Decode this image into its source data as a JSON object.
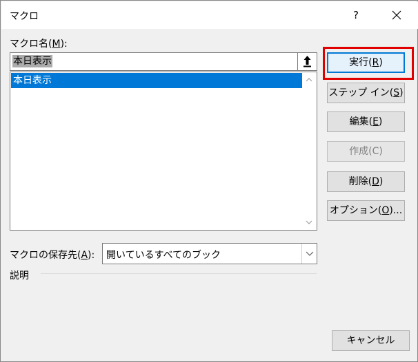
{
  "window": {
    "title": "マクロ",
    "help_label": "?",
    "close_icon": "close-icon"
  },
  "macro_name": {
    "label_pre": "マクロ名(",
    "label_key": "M",
    "label_post": "):",
    "value": "本日表示"
  },
  "macro_list": {
    "items": [
      "本日表示"
    ],
    "selected_index": 0
  },
  "macros_in": {
    "label_pre": "マクロの保存先(",
    "label_key": "A",
    "label_post": "):",
    "value": "開いているすべてのブック"
  },
  "description": {
    "label": "説明"
  },
  "buttons": {
    "run": {
      "pre": "実行(",
      "key": "R",
      "post": ")"
    },
    "step_into": {
      "pre": "ステップ イン(",
      "key": "S",
      "post": ")"
    },
    "edit": {
      "pre": "編集(",
      "key": "E",
      "post": ")"
    },
    "create": {
      "label": "作成(C)"
    },
    "delete": {
      "pre": "削除(",
      "key": "D",
      "post": ")"
    },
    "options": {
      "pre": "オプション(",
      "key": "O",
      "post": ")..."
    },
    "cancel": {
      "label": "キャンセル"
    }
  },
  "colors": {
    "selection": "#0078d7",
    "highlight_box": "#e00000",
    "default_button_border": "#0078d7"
  }
}
